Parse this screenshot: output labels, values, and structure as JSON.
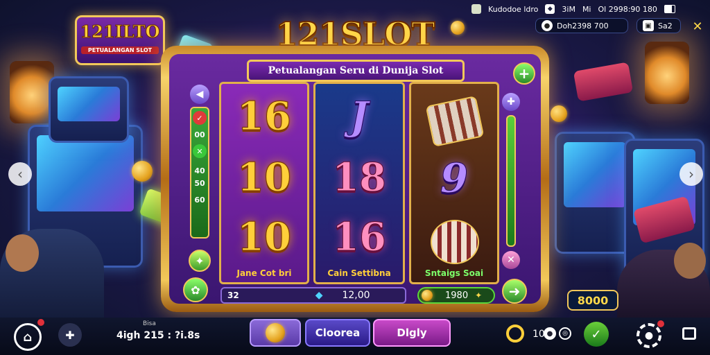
{
  "logo": {
    "title": "121ILTO",
    "subtitle": "PETUALANGAN SLOT"
  },
  "status_bar": {
    "item1": "Kudodoe ldro",
    "item2": "3iM",
    "item3": "Mi",
    "item4": "Ol 2998:90 180",
    "balance_pill": "Doh2398 700",
    "small_pill": "Sa2"
  },
  "game": {
    "title": "121SLOT",
    "subtitle": "Petualangan Seru di Dunija Slot",
    "reels": [
      {
        "symbols": [
          "16",
          "10",
          "10"
        ],
        "label": "Jane Cot bri"
      },
      {
        "symbols": [
          "J",
          "18",
          "16"
        ],
        "label": "Cain Settibna"
      },
      {
        "symbols": [
          "",
          "9",
          ""
        ],
        "label": "Sntaigs Soai"
      }
    ],
    "left_panel": {
      "line1": "00",
      "line2": "40",
      "line3": "50",
      "line4": "60"
    },
    "bet_label": "32",
    "bet_value": "12,00",
    "win_value": "1980",
    "credit_badge": "8000"
  },
  "bottom_bar": {
    "account_label": "Bisa",
    "account_value": "4igh 215 : ?i.8s",
    "btn_confirm": "Cloorea",
    "btn_play": "Dlgly",
    "counter": "10"
  },
  "colors": {
    "gold": "#f2c85a",
    "purple": "#6a2aa0",
    "green": "#3aa83a"
  }
}
